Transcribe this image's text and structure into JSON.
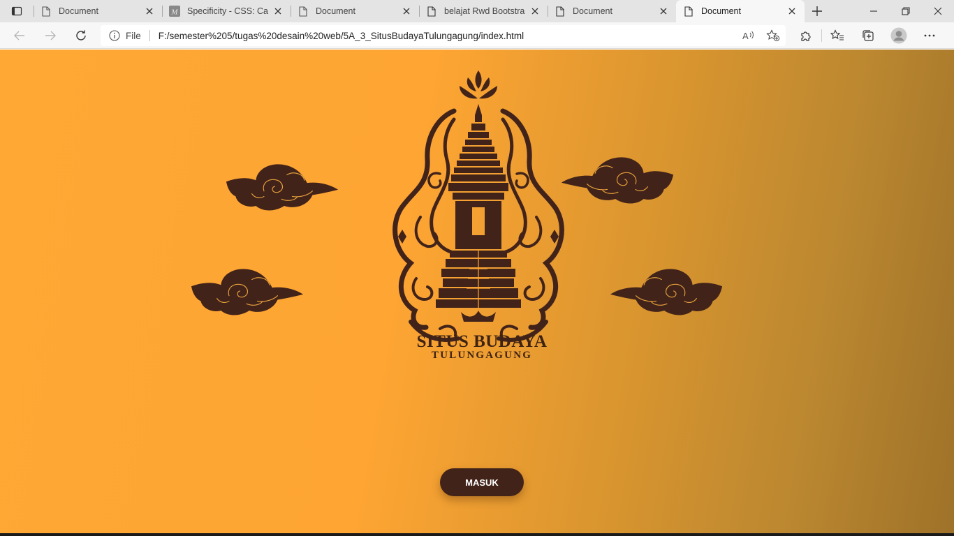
{
  "browser": {
    "tabs": [
      {
        "title": "Document",
        "favicon": "page-icon",
        "active": false
      },
      {
        "title": "Specificity - CSS: Cascading Style Sheets",
        "favicon": "mdn-icon",
        "active": false
      },
      {
        "title": "Document",
        "favicon": "page-icon",
        "active": false
      },
      {
        "title": "belajat Rwd Bootstrap",
        "favicon": "page-icon",
        "active": false
      },
      {
        "title": "Document",
        "favicon": "page-icon",
        "active": false
      },
      {
        "title": "Document",
        "favicon": "page-icon",
        "active": true
      }
    ],
    "address": {
      "scheme_label": "File",
      "url": "F:/semester%205/tugas%20desain%20web/5A_3_SitusBudayaTulungagung/index.html"
    }
  },
  "page": {
    "brand_title": "SITUS BUDAYA",
    "brand_subtitle": "TULUNGAGUNG",
    "enter_button": "MASUK",
    "colors": {
      "background_start": "#ffa834",
      "background_end": "#9e7229",
      "ornament": "#42231a",
      "button": "#42231a"
    }
  }
}
